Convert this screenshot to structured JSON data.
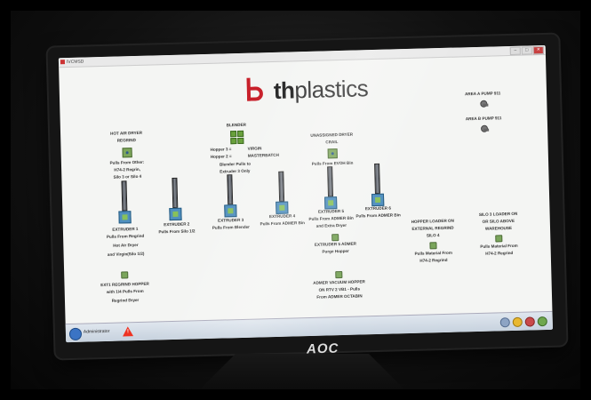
{
  "window": {
    "title": "IVCMSD"
  },
  "logo": {
    "prefix": "th",
    "suffix": "plastics"
  },
  "hot_air_dryer": {
    "title": "HOT AIR DRYER",
    "subtitle": "REGRIND",
    "line1": "Pulls From Other:",
    "line2": "H74-2 Regrin,",
    "line3": "Silo 3 or Silo 4"
  },
  "blender": {
    "title": "BLENDER",
    "hopper3": "Hopper 3 =",
    "hopper2": "Hopper 2 =",
    "virgin": "VIRGIN",
    "masterbatch": "MASTERBATCH",
    "pulls": "Blender Pulls to",
    "extruder": "Extruder 3 Only"
  },
  "unassigned_dryer": {
    "title": "UNASSIGNED DRYER",
    "subtitle": "CRAIL",
    "pulls": "Pulls From EVOH Bin"
  },
  "pumps": {
    "a": "AREA A PUMP 911",
    "b": "AREA B PUMP 911"
  },
  "extruders": [
    {
      "name": "EXTRUDER 1",
      "l1": "Pulls From Regrind",
      "l2": "Hot Air Dryer",
      "l3": "and Virgin(Silo 1/2)"
    },
    {
      "name": "EXTRUDER 2",
      "l1": "Pulls From Silo 1/2",
      "l2": "",
      "l3": ""
    },
    {
      "name": "EXTRUDER 3",
      "l1": "Pulls From Blender",
      "l2": "",
      "l3": ""
    },
    {
      "name": "EXTRUDER 4",
      "l1": "Pulls From ADMER Bin",
      "l2": "",
      "l3": ""
    },
    {
      "name": "EXTRUDER 5",
      "l1": "Pulls From ADMER Bin",
      "l2": "and Extra Dryer",
      "l3": ""
    },
    {
      "name": "EXTRUDER 6",
      "l1": "Pulls From ADMER Bin",
      "l2": "",
      "l3": ""
    }
  ],
  "ext5_admer": {
    "l1": "EXTRUDER 5 ADMER",
    "l2": "Purge Hopper"
  },
  "admer_vacuum": {
    "l1": "ADMER VACUUM HOPPER",
    "l2": "ON RTV 2 VB1 - Pulls",
    "l3": "From ADMER OCTABIN"
  },
  "ext1_hopper": {
    "l1": "EXT1 REGRIND HOPPER",
    "l2": "with 1/4 Pulls From",
    "l3": "Regrind Dryer"
  },
  "silo4_loader": {
    "l1": "HOPPER LOADER ON",
    "l2": "EXTERNAL REGRIND",
    "l3": "SILO 4",
    "l4": "Pulls Material From",
    "l5": "H74-2 Regrind"
  },
  "silo3_loader": {
    "l1": "SILO 3 LOADER ON",
    "l2": "OR SILO ABOVE",
    "l3": "WAREHOUSE",
    "l4": "Pulls Material From",
    "l5": "H74-2 Regrind"
  },
  "taskbar": {
    "item": "Administrator"
  },
  "monitor": {
    "brand": "AOC"
  }
}
